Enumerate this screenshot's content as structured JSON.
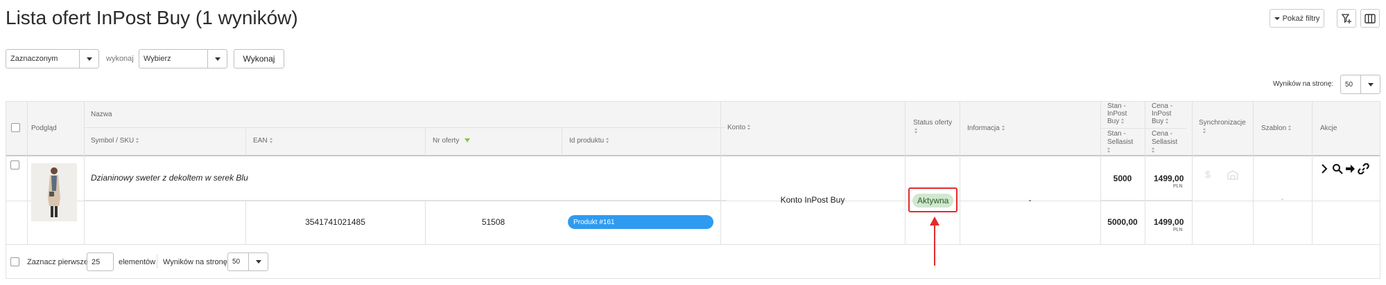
{
  "page": {
    "title": "Lista ofert InPost Buy (1 wyników)"
  },
  "toolbar": {
    "show_filters": "Pokaż filtry",
    "filter_icon": "filter-add-icon",
    "columns_icon": "columns-icon"
  },
  "bulk": {
    "scope_value": "Zaznaczonym",
    "execute_label": "wykonaj",
    "action_value": "Wybierz",
    "execute_button": "Wykonaj"
  },
  "pagination_top": {
    "label": "Wyników na stronę:",
    "value": "50"
  },
  "table": {
    "headers": {
      "preview": "Podgląd",
      "name": "Nazwa",
      "symbol": "Symbol / SKU",
      "ean": "EAN",
      "offer_no": "Nr oferty",
      "product_id": "Id produktu",
      "account": "Konto",
      "status": "Status oferty",
      "info": "Informacja",
      "stock_inpost_l1": "Stan -",
      "stock_inpost_l2": "InPost",
      "stock_inpost_l3": "Buy",
      "price_inpost_l1": "Cena -",
      "price_inpost_l2": "InPost",
      "price_inpost_l3": "Buy",
      "stock_sellasist_l1": "Stan -",
      "stock_sellasist_l2": "Sellasist",
      "price_sellasist_l1": "Cena -",
      "price_sellasist_l2": "Sellasist",
      "sync": "Synchronizacje",
      "template": "Szablon",
      "actions": "Akcje"
    },
    "rows": [
      {
        "name": "Dzianinowy sweter z dekoltem w serek Blu",
        "symbol": "",
        "ean": "3541741021485",
        "offer_no": "51508",
        "product_id": "Produkt #161",
        "account": "Konto InPost Buy",
        "status": "Aktywna",
        "info": "-",
        "stock_inpost": "5000",
        "price_inpost": "1499,00",
        "price_inpost_currency": "PLN",
        "stock_sellasist": "5000,00",
        "price_sellasist": "1499,00",
        "price_sellasist_currency": "PLN",
        "template": "-",
        "sync_icons": [
          "dollar-icon",
          "warehouse-icon"
        ],
        "action_icons": [
          "chevron-right-icon",
          "search-icon",
          "arrow-right-icon",
          "link-icon"
        ]
      }
    ]
  },
  "footer": {
    "select_first_label": "Zaznacz pierwsze",
    "select_first_value": "25",
    "elements_label": "elementów",
    "per_page_label": "Wyników na stronę:",
    "per_page_value": "50"
  },
  "colors": {
    "status_badge_bg": "#cfe8cf",
    "product_pill_bg": "#2e9bf0",
    "highlight_red": "#e32b2b",
    "sort_active": "#8bc34a"
  }
}
